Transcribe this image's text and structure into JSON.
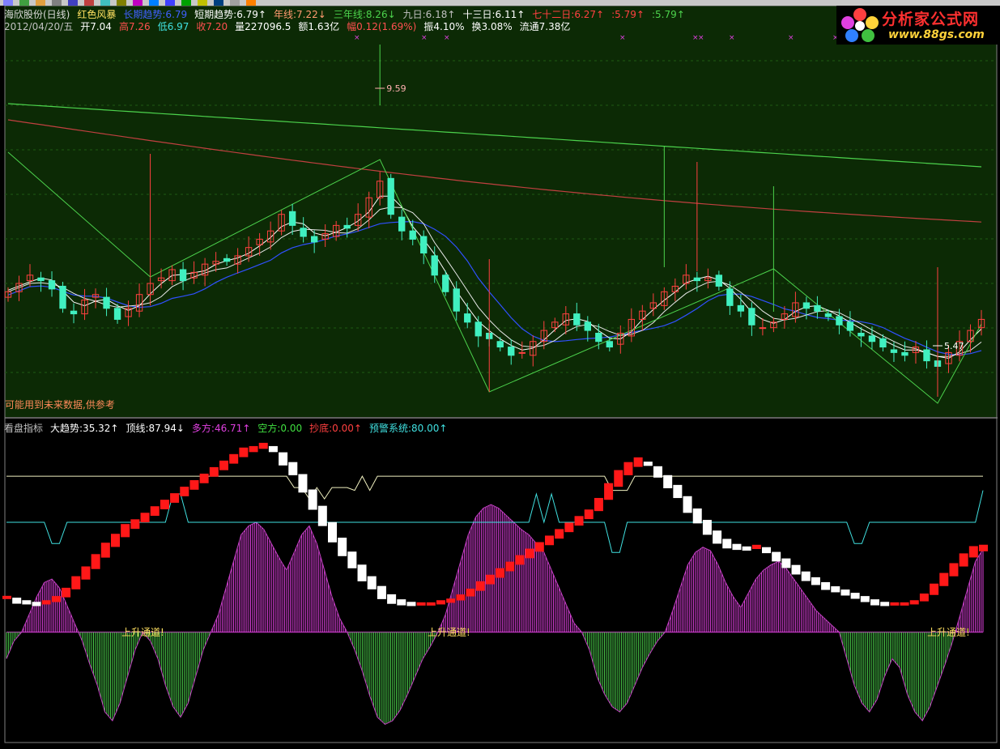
{
  "header": {
    "line1": [
      {
        "text": "海欣股份(日线)",
        "color": "#d9d9d9"
      },
      {
        "text": "红色风暴",
        "color": "#ffe060"
      },
      {
        "text": "长期趋势:6.79",
        "color": "#4060ff"
      },
      {
        "text": "短期趋势:6.79↑",
        "color": "#ffffff"
      },
      {
        "text": "年线:7.22↓",
        "color": "#ff9a70"
      },
      {
        "text": "三年线:8.26↓",
        "color": "#4cd24c"
      },
      {
        "text": "九日:6.18↑",
        "color": "#c0c0c0"
      },
      {
        "text": "十三日:6.11↑",
        "color": "#ffffff"
      },
      {
        "text": "七十二日:6.27↑",
        "color": "#ff4040"
      },
      {
        "text": ":5.79↑",
        "color": "#ff4040"
      },
      {
        "text": ":5.79↑",
        "color": "#4cd24c"
      }
    ],
    "line2": [
      {
        "text": "2012/04/20/五",
        "color": "#c0c0c0"
      },
      {
        "text": "开7.04",
        "color": "#ffffff"
      },
      {
        "text": "高7.26",
        "color": "#ff5050"
      },
      {
        "text": "低6.97",
        "color": "#40e0e0"
      },
      {
        "text": "收7.20",
        "color": "#ff5050"
      },
      {
        "text": "量227096.5",
        "color": "#ffffff"
      },
      {
        "text": "额1.63亿",
        "color": "#ffffff"
      },
      {
        "text": "幅0.12(1.69%)",
        "color": "#ff5050"
      },
      {
        "text": "振4.10%",
        "color": "#ffffff"
      },
      {
        "text": "换3.08%",
        "color": "#ffffff"
      },
      {
        "text": "流通7.38亿",
        "color": "#ffffff"
      }
    ],
    "notice": "可能用到未来数据,供参考"
  },
  "indicator_header": [
    {
      "text": "看盘指标",
      "color": "#c0c0c0"
    },
    {
      "text": "大趋势:35.32↑",
      "color": "#ffffff"
    },
    {
      "text": "顶线:87.94↓",
      "color": "#ffffff"
    },
    {
      "text": "多方:46.71↑",
      "color": "#e040e0"
    },
    {
      "text": "空方:0.00",
      "color": "#40e040"
    },
    {
      "text": "抄底:0.00↑",
      "color": "#ff4040"
    },
    {
      "text": "预警系统:80.00↑",
      "color": "#40e0e0"
    }
  ],
  "logo": {
    "title": "分析家公式网",
    "url": "www.88gs.com"
  },
  "colors": {
    "background": "#000000",
    "price_panel_bg": "#0c2a05",
    "up_candle": "#ff4040",
    "down_candle": "#40f0c0",
    "green_line": "#4cd24c",
    "red_line": "#ff4040",
    "white_line": "#ffffff",
    "blue_line": "#3050ff",
    "magenta": "#e040e0",
    "cyan": "#40e0e0",
    "yellow_label": "#ffe060"
  },
  "chart_data": [
    {
      "type": "candlestick",
      "title": "海欣股份(日线)",
      "y_range": [
        5.0,
        10.2
      ],
      "annotations": [
        {
          "text": "9.59",
          "color": "#ffb0b0"
        },
        {
          "text": "5.47",
          "color": "#ffffff"
        }
      ],
      "close": [
        6.9,
        7.05,
        7.2,
        7.1,
        6.95,
        6.6,
        6.5,
        6.75,
        6.85,
        6.6,
        6.4,
        6.6,
        6.85,
        7.05,
        7.15,
        7.3,
        7.1,
        7.25,
        7.4,
        7.45,
        7.45,
        7.55,
        7.7,
        7.85,
        8.0,
        8.3,
        8.1,
        7.9,
        7.8,
        7.95,
        8.1,
        8.05,
        8.3,
        8.6,
        8.9,
        8.3,
        8.0,
        7.85,
        7.6,
        7.2,
        6.9,
        6.55,
        6.35,
        6.1,
        6.05,
        5.9,
        5.75,
        5.8,
        6.0,
        6.2,
        6.35,
        6.5,
        6.3,
        6.2,
        6.0,
        5.9,
        6.15,
        6.4,
        6.55,
        6.7,
        6.9,
        7.0,
        7.2,
        7.1,
        7.15,
        7.0,
        6.65,
        6.55,
        6.3,
        6.25,
        6.35,
        6.5,
        6.7,
        6.6,
        6.55,
        6.45,
        6.3,
        6.2,
        6.1,
        6.0,
        5.9,
        5.8,
        5.75,
        5.9,
        5.65,
        5.55,
        5.8,
        6.0,
        6.2,
        6.4
      ],
      "marks": {
        "high_label_index": 34,
        "low_label_index": 85,
        "trough_indices": [
          13,
          44,
          85
        ],
        "series_ma_short": "white",
        "series_ma_mid": "white",
        "series_ma_blue": "blue",
        "series_long": [
          {
            "name": "年线",
            "color": "#ff4040"
          },
          {
            "name": "三年线",
            "color": "#4cd24c"
          }
        ]
      }
    },
    {
      "type": "indicator",
      "title": "看盘指标",
      "y_range": [
        -60,
        110
      ],
      "levels": {
        "大趋势": 35.32,
        "顶线": 87.94,
        "多方": 46.71,
        "空方": 0.0,
        "抄底": 0.0,
        "预警系统": 80.0
      },
      "annotations": [
        {
          "text": "上升通道!",
          "color": "#ffe060"
        },
        {
          "text": "上升通道!",
          "color": "#ffe060"
        },
        {
          "text": "上升通道!",
          "color": "#ffe060"
        }
      ],
      "trend": [
        5,
        3,
        2,
        1,
        2,
        4,
        8,
        14,
        20,
        27,
        34,
        40,
        46,
        50,
        54,
        58,
        62,
        66,
        70,
        74,
        78,
        82,
        86,
        90,
        94,
        96,
        98,
        96,
        90,
        84,
        75,
        65,
        55,
        45,
        36,
        28,
        20,
        14,
        8,
        4,
        2,
        1,
        1,
        1,
        2,
        3,
        5,
        8,
        12,
        16,
        20,
        24,
        28,
        32,
        36,
        40,
        44,
        48,
        52,
        56,
        62,
        70,
        78,
        84,
        88,
        87,
        82,
        76,
        70,
        62,
        55,
        48,
        42,
        38,
        36,
        35,
        36,
        34,
        30,
        26,
        22,
        18,
        15,
        12,
        10,
        8,
        6,
        4,
        2,
        1,
        1,
        1,
        2,
        5,
        10,
        16,
        22,
        28,
        33,
        35.32
      ],
      "bars": [
        -15,
        -5,
        0,
        10,
        20,
        28,
        30,
        25,
        15,
        5,
        -5,
        -18,
        -30,
        -45,
        -50,
        -40,
        -25,
        -10,
        0,
        -5,
        -15,
        -30,
        -42,
        -48,
        -40,
        -25,
        -10,
        0,
        10,
        25,
        40,
        55,
        60,
        62,
        58,
        50,
        42,
        35,
        45,
        55,
        60,
        50,
        35,
        20,
        8,
        0,
        -10,
        -22,
        -36,
        -48,
        -52,
        -50,
        -44,
        -35,
        -25,
        -15,
        -8,
        0,
        10,
        25,
        40,
        55,
        65,
        70,
        72,
        70,
        66,
        62,
        58,
        55,
        50,
        45,
        35,
        25,
        15,
        5,
        0,
        -10,
        -25,
        -35,
        -42,
        -45,
        -40,
        -30,
        -20,
        -12,
        -5,
        0,
        12,
        25,
        38,
        45,
        48,
        46,
        38,
        28,
        20,
        14,
        22,
        30,
        35,
        38,
        40,
        36,
        30,
        24,
        18,
        12,
        8,
        4,
        0,
        -15,
        -30,
        -40,
        -45,
        -38,
        -25,
        -15,
        -20,
        -35,
        -45,
        -50,
        -42,
        -30,
        -18,
        -5,
        10,
        25,
        40,
        46.71
      ]
    }
  ]
}
